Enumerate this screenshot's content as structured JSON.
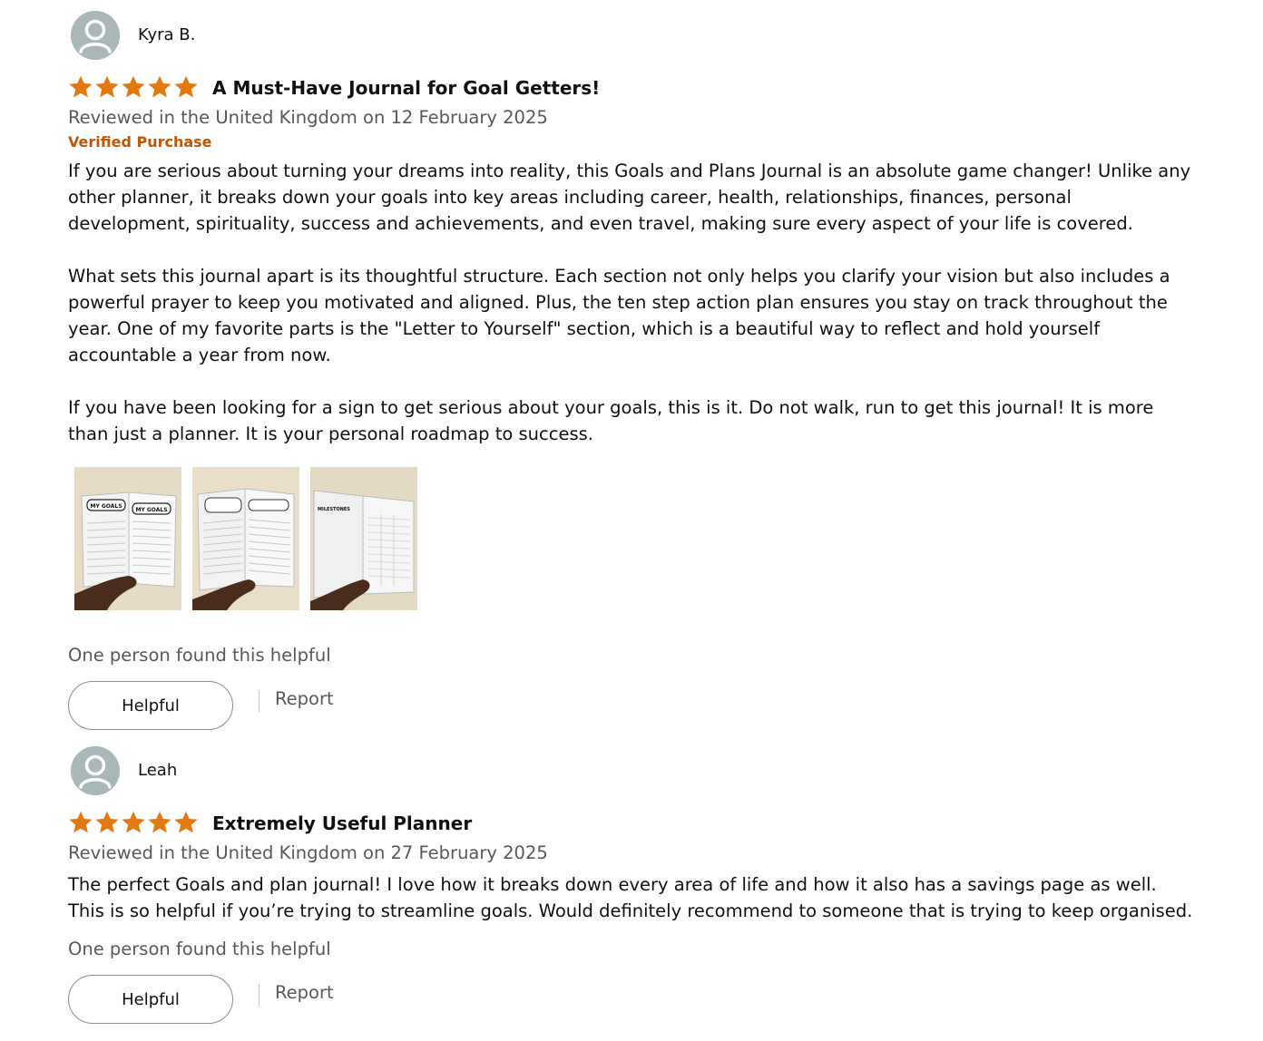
{
  "reviews": [
    {
      "profile_name": "Kyra B.",
      "rating": 5,
      "rating_max": 5,
      "title": "A Must-Have Journal for Goal Getters!",
      "date_text": "Reviewed in the United Kingdom on 12 February 2025",
      "verified": "Verified Purchase",
      "body": "If you are serious about turning your dreams into reality, this Goals and Plans Journal is an absolute game changer! Unlike any other planner, it breaks down your goals into key areas including career, health, relationships, finances, personal development, spirituality, success and achievements, and even travel, making sure every aspect of your life is covered.\n\nWhat sets this journal apart is its thoughtful structure. Each section not only helps you clarify your vision but also includes a powerful prayer to keep you motivated and aligned. Plus, the ten step action plan ensures you stay on track throughout the year. One of my favorite parts is the \"Letter to Yourself\" section, which is a beautiful way to reflect and hold yourself accountable a year from now.\n\nIf you have been looking for a sign to get serious about your goals, this is it. Do not walk, run to get this journal! It is more than just a planner. It is your personal roadmap to success.",
      "images": [
        {
          "left_heading": "MY GOALS",
          "right_heading": "MY GOALS"
        },
        {
          "left_heading": "",
          "right_heading": ""
        },
        {
          "left_heading": "MILESTONES",
          "right_heading": ""
        }
      ],
      "helpful_count_text": "One person found this helpful",
      "helpful_label": "Helpful",
      "report_label": "Report"
    },
    {
      "profile_name": "Leah",
      "rating": 5,
      "rating_max": 5,
      "title": "Extremely Useful Planner",
      "date_text": "Reviewed in the United Kingdom on 27 February 2025",
      "body": "The perfect Goals and plan journal! I love how it breaks down every area of life and how it also has a savings page as well. This is so helpful if you’re trying to streamline goals. Would definitely recommend to someone that is trying to keep organised.",
      "helpful_count_text": "One person found this helpful",
      "helpful_label": "Helpful",
      "report_label": "Report"
    }
  ],
  "colors": {
    "star": "#e47911",
    "verified": "#c45500",
    "muted_text": "#565959",
    "avatar_bg": "#aab7b8"
  },
  "icons": {
    "avatar": "default-profile-icon",
    "star": "filled-star-icon"
  }
}
